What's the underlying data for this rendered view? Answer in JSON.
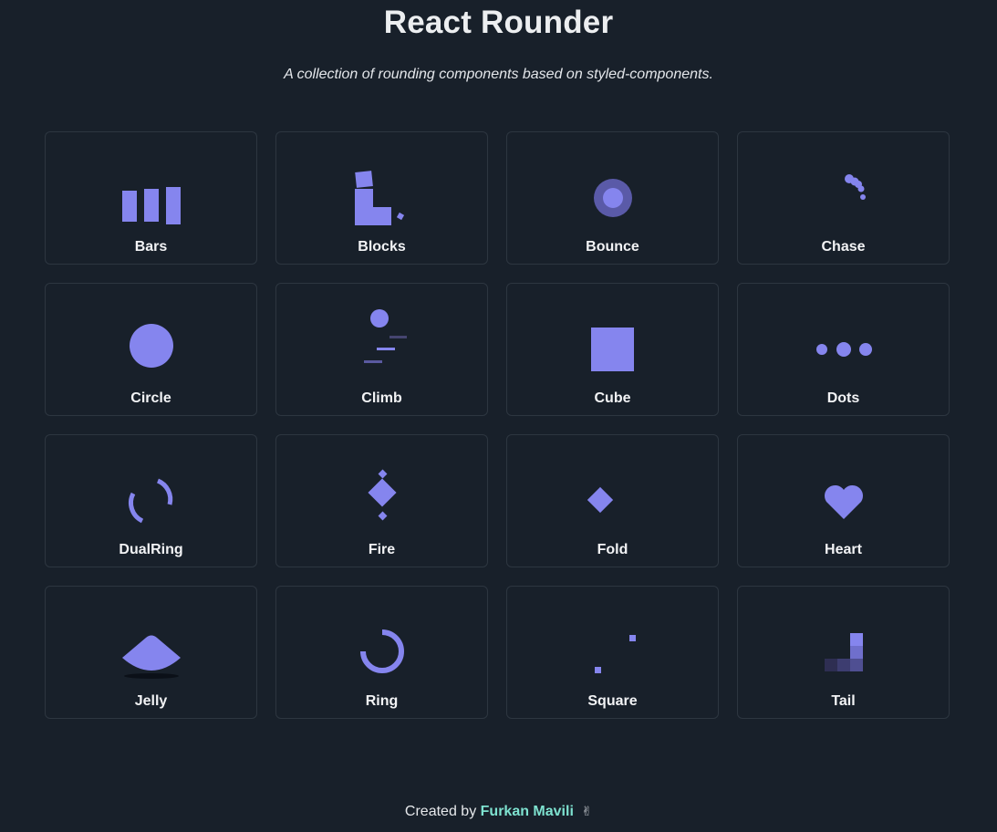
{
  "header": {
    "title": "React Rounder",
    "subtitle": "A collection of rounding components based on styled-components."
  },
  "theme": {
    "background": "#18202a",
    "accent": "#8585ee",
    "card_border": "#2d3640",
    "link": "#7ee2d0"
  },
  "cards": [
    {
      "label": "Bars",
      "icon": "bars-icon"
    },
    {
      "label": "Blocks",
      "icon": "blocks-icon"
    },
    {
      "label": "Bounce",
      "icon": "bounce-icon"
    },
    {
      "label": "Chase",
      "icon": "chase-icon"
    },
    {
      "label": "Circle",
      "icon": "circle-icon"
    },
    {
      "label": "Climb",
      "icon": "climb-icon"
    },
    {
      "label": "Cube",
      "icon": "cube-icon"
    },
    {
      "label": "Dots",
      "icon": "dots-icon"
    },
    {
      "label": "DualRing",
      "icon": "dual-ring-icon"
    },
    {
      "label": "Fire",
      "icon": "fire-icon"
    },
    {
      "label": "Fold",
      "icon": "fold-icon"
    },
    {
      "label": "Heart",
      "icon": "heart-icon"
    },
    {
      "label": "Jelly",
      "icon": "jelly-icon"
    },
    {
      "label": "Ring",
      "icon": "ring-icon"
    },
    {
      "label": "Square",
      "icon": "square-icon"
    },
    {
      "label": "Tail",
      "icon": "tail-icon"
    }
  ],
  "footer": {
    "prefix": "Created by",
    "author": "Furkan Mavili",
    "emoji": "✌"
  }
}
